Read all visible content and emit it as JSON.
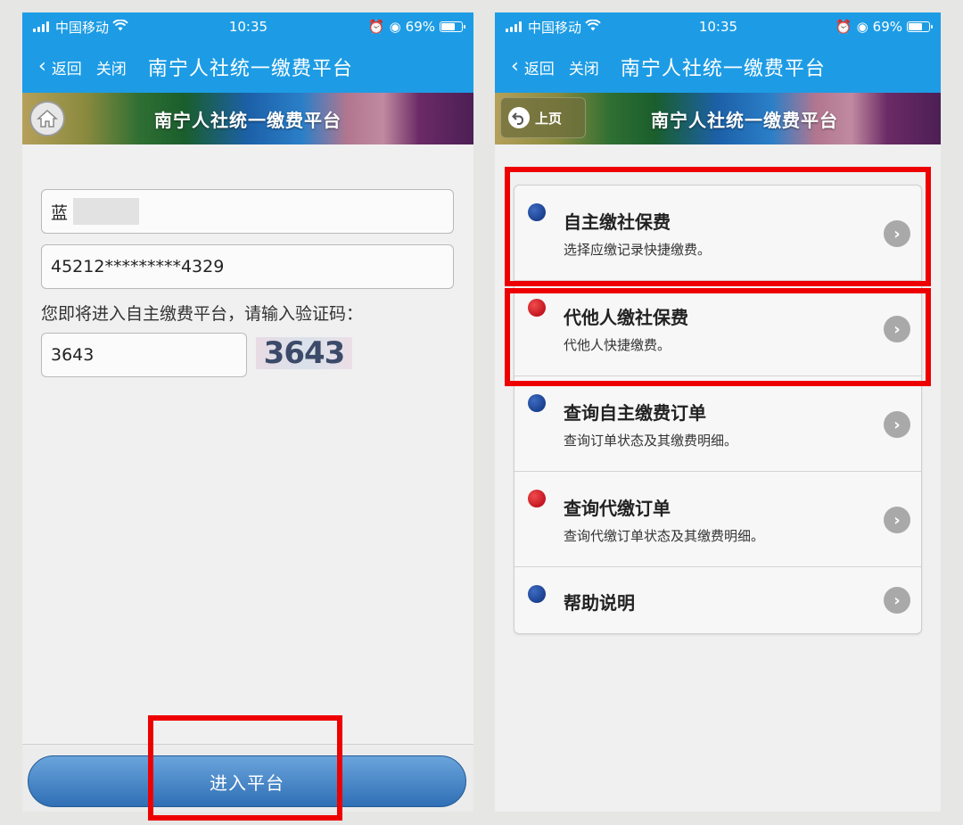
{
  "status": {
    "carrier": "中国移动",
    "time": "10:35",
    "battery": "69%"
  },
  "nav": {
    "back_label": "返回",
    "close_label": "关闭",
    "title": "南宁人社统一缴费平台"
  },
  "banner": {
    "title": "南宁人社统一缴费平台",
    "prev_label": "上页"
  },
  "login": {
    "name_value": "蓝",
    "id_value": "45212*********4329",
    "prompt": "您即将进入自主缴费平台，请输入验证码：",
    "captcha_value": "3643",
    "captcha_image_text": "3643",
    "enter_label": "进入平台"
  },
  "menu": {
    "items": [
      {
        "title": "自主缴社保费",
        "subtitle": "选择应缴记录快捷缴费。",
        "dot": "blue"
      },
      {
        "title": "代他人缴社保费",
        "subtitle": "代他人快捷缴费。",
        "dot": "red"
      },
      {
        "title": "查询自主缴费订单",
        "subtitle": "查询订单状态及其缴费明细。",
        "dot": "blue"
      },
      {
        "title": "查询代缴订单",
        "subtitle": "查询代缴订单状态及其缴费明细。",
        "dot": "red"
      },
      {
        "title": "帮助说明",
        "subtitle": "",
        "dot": "blue"
      }
    ]
  },
  "colors": {
    "nav_blue": "#1d9ce5",
    "highlight_red": "#ee0000",
    "dot_blue": "#0b2f7a",
    "dot_red": "#b00010"
  }
}
